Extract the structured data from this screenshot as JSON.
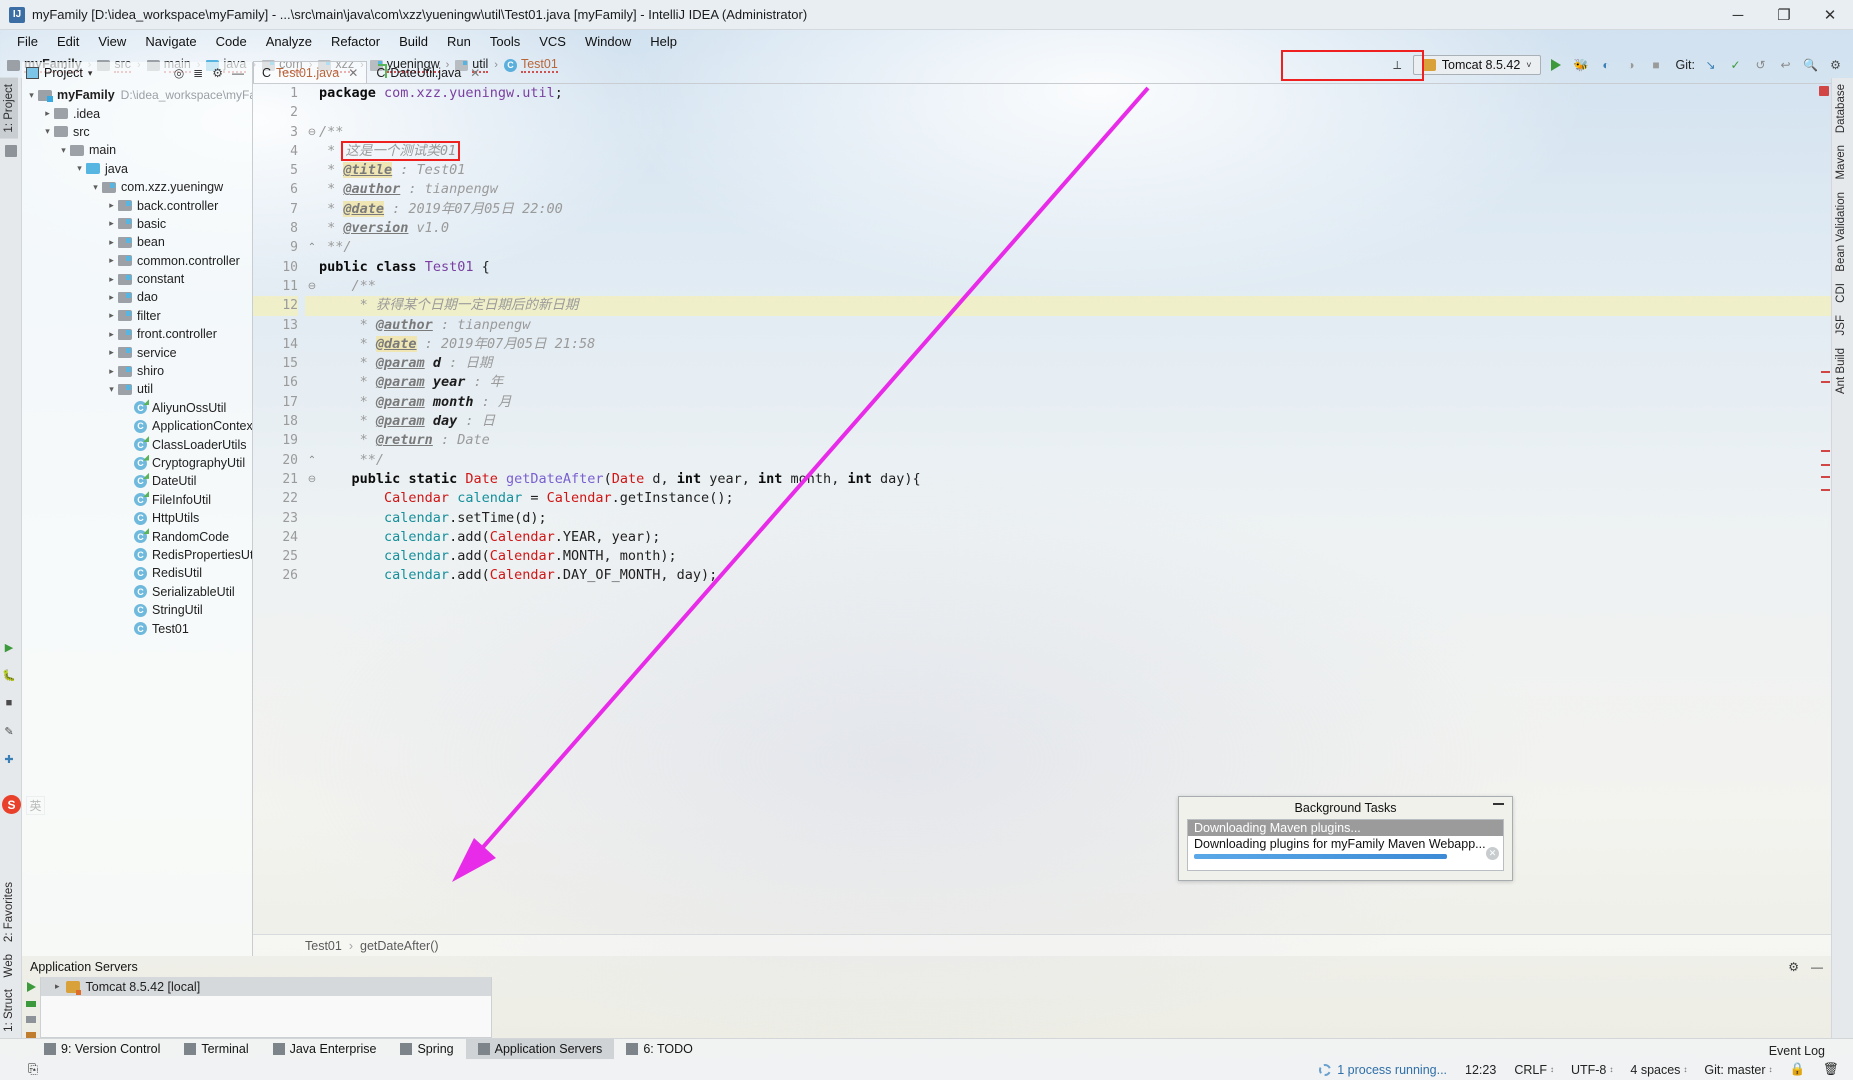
{
  "titlebar": {
    "app_icon": "intellij-logo-icon",
    "title": "myFamily [D:\\idea_workspace\\myFamily] - ...\\src\\main\\java\\com\\xzz\\yueningw\\util\\Test01.java [myFamily] - IntelliJ IDEA (Administrator)",
    "minimize": "─",
    "maximize": "❐",
    "close": "✕"
  },
  "menubar": {
    "items": [
      "File",
      "Edit",
      "View",
      "Navigate",
      "Code",
      "Analyze",
      "Refactor",
      "Build",
      "Run",
      "Tools",
      "VCS",
      "Window",
      "Help"
    ]
  },
  "breadcrumbs": [
    {
      "label": "myFamily",
      "icon": "project-folder-icon",
      "bold": true
    },
    {
      "label": "src",
      "icon": "folder-icon",
      "bold": false
    },
    {
      "label": "main",
      "icon": "folder-icon",
      "bold": false
    },
    {
      "label": "java",
      "icon": "source-folder-icon",
      "bold": false
    },
    {
      "label": "com",
      "icon": "package-icon",
      "bold": false
    },
    {
      "label": "xzz",
      "icon": "package-icon",
      "bold": false
    },
    {
      "label": "yueningw",
      "icon": "package-icon",
      "bold": false
    },
    {
      "label": "util",
      "icon": "package-icon",
      "bold": false
    },
    {
      "label": "Test01",
      "icon": "java-class-icon",
      "bold": false
    }
  ],
  "toolbar": {
    "run_config": "Tomcat 8.5.42",
    "run_config_icon": "tomcat-cat-icon",
    "dropdown_caret": "˅",
    "run_button": "run-icon",
    "debug_button": "debug-icon",
    "run_coverage_button": "run-with-coverage-icon",
    "profile_button": "profile-icon",
    "stop_button": "stop-icon",
    "git_label": "Git:",
    "git_update": "update-project-icon",
    "git_commit": "commit-icon",
    "git_history": "history-icon",
    "git_revert": "revert-icon",
    "search_everywhere": "magnifier-icon",
    "settings": "gear-icon",
    "highlight_box_color": "#ef2020"
  },
  "left_strip": {
    "top_tabs": [
      {
        "label": "1: Project",
        "active": true
      }
    ],
    "bottom_tabs": [
      {
        "label": "2: Favorites",
        "active": false
      },
      {
        "label": "Web",
        "active": false
      },
      {
        "label": "1: Struct",
        "active": false
      }
    ]
  },
  "right_strip": {
    "tabs": [
      "Database",
      "Maven",
      "Bean Validation",
      "CDI",
      "JSF",
      "Ant Build"
    ]
  },
  "project_panel": {
    "title": "Project",
    "caret": "▾",
    "icons": [
      "locate-icon",
      "collapse-all-icon",
      "gear-icon",
      "hide-icon"
    ],
    "tree": [
      {
        "depth": 0,
        "arrow": "open",
        "icon": "project-folder-icon",
        "label": "myFamily",
        "bold": true,
        "path": "D:\\idea_workspace\\myFamil"
      },
      {
        "depth": 1,
        "arrow": "closed",
        "icon": "folder-icon",
        "label": ".idea"
      },
      {
        "depth": 1,
        "arrow": "open",
        "icon": "folder-icon",
        "label": "src"
      },
      {
        "depth": 2,
        "arrow": "open",
        "icon": "folder-icon",
        "label": "main"
      },
      {
        "depth": 3,
        "arrow": "open",
        "icon": "source-folder-icon",
        "label": "java"
      },
      {
        "depth": 4,
        "arrow": "open",
        "icon": "package-icon",
        "label": "com.xzz.yueningw"
      },
      {
        "depth": 5,
        "arrow": "closed",
        "icon": "package-icon",
        "label": "back.controller"
      },
      {
        "depth": 5,
        "arrow": "closed",
        "icon": "package-icon",
        "label": "basic"
      },
      {
        "depth": 5,
        "arrow": "closed",
        "icon": "package-icon",
        "label": "bean"
      },
      {
        "depth": 5,
        "arrow": "closed",
        "icon": "package-icon",
        "label": "common.controller"
      },
      {
        "depth": 5,
        "arrow": "closed",
        "icon": "package-icon",
        "label": "constant"
      },
      {
        "depth": 5,
        "arrow": "closed",
        "icon": "package-icon",
        "label": "dao"
      },
      {
        "depth": 5,
        "arrow": "closed",
        "icon": "package-icon",
        "label": "filter"
      },
      {
        "depth": 5,
        "arrow": "closed",
        "icon": "package-icon",
        "label": "front.controller"
      },
      {
        "depth": 5,
        "arrow": "closed",
        "icon": "package-icon",
        "label": "service"
      },
      {
        "depth": 5,
        "arrow": "closed",
        "icon": "package-icon",
        "label": "shiro"
      },
      {
        "depth": 5,
        "arrow": "open",
        "icon": "package-icon",
        "label": "util"
      },
      {
        "depth": 6,
        "arrow": "none",
        "icon": "java-class-public-icon",
        "label": "AliyunOssUtil"
      },
      {
        "depth": 6,
        "arrow": "none",
        "icon": "java-class-icon",
        "label": "ApplicationContext"
      },
      {
        "depth": 6,
        "arrow": "none",
        "icon": "java-class-public-icon",
        "label": "ClassLoaderUtils"
      },
      {
        "depth": 6,
        "arrow": "none",
        "icon": "java-class-public-icon",
        "label": "CryptographyUtil"
      },
      {
        "depth": 6,
        "arrow": "none",
        "icon": "java-class-public-icon",
        "label": "DateUtil"
      },
      {
        "depth": 6,
        "arrow": "none",
        "icon": "java-class-public-icon",
        "label": "FileInfoUtil"
      },
      {
        "depth": 6,
        "arrow": "none",
        "icon": "java-class-icon",
        "label": "HttpUtils"
      },
      {
        "depth": 6,
        "arrow": "none",
        "icon": "java-class-public-icon",
        "label": "RandomCode"
      },
      {
        "depth": 6,
        "arrow": "none",
        "icon": "java-class-icon",
        "label": "RedisPropertiesUtil"
      },
      {
        "depth": 6,
        "arrow": "none",
        "icon": "java-class-icon",
        "label": "RedisUtil"
      },
      {
        "depth": 6,
        "arrow": "none",
        "icon": "java-class-icon",
        "label": "SerializableUtil"
      },
      {
        "depth": 6,
        "arrow": "none",
        "icon": "java-class-icon",
        "label": "StringUtil"
      },
      {
        "depth": 6,
        "arrow": "none",
        "icon": "java-class-icon",
        "label": "Test01"
      }
    ]
  },
  "editor": {
    "tabs": [
      {
        "label": "Test01.java",
        "icon": "java-class-icon",
        "active": true,
        "close": "✕"
      },
      {
        "label": "DateUtil.java",
        "icon": "java-class-public-icon",
        "active": false,
        "close": "✕"
      }
    ],
    "first_line": 1,
    "last_line": 26,
    "highlight_line": 12,
    "red_outline_line": 4,
    "breadcrumb": {
      "class": "Test01",
      "separator": "›",
      "method": "getDateAfter()"
    },
    "lines": [
      {
        "n": 1,
        "fold": "",
        "text": "package com.xzz.yueningw.util;"
      },
      {
        "n": 2,
        "fold": "",
        "text": ""
      },
      {
        "n": 3,
        "fold": "-",
        "text": "/**"
      },
      {
        "n": 4,
        "fold": "",
        "text": " * 这是一个测试类01"
      },
      {
        "n": 5,
        "fold": "",
        "text": " * @title : Test01"
      },
      {
        "n": 6,
        "fold": "",
        "text": " * @author : tianpengw"
      },
      {
        "n": 7,
        "fold": "",
        "text": " * @date : 2019年07月05日 22:00"
      },
      {
        "n": 8,
        "fold": "",
        "text": " * @version v1.0"
      },
      {
        "n": 9,
        "fold": "^",
        "text": " **/"
      },
      {
        "n": 10,
        "fold": "",
        "text": "public class Test01 {"
      },
      {
        "n": 11,
        "fold": "-",
        "text": "    /**"
      },
      {
        "n": 12,
        "fold": "",
        "text": "     * 获得某个日期一定日期后的新日期"
      },
      {
        "n": 13,
        "fold": "",
        "text": "     * @author : tianpengw"
      },
      {
        "n": 14,
        "fold": "",
        "text": "     * @date : 2019年07月05日 21:58"
      },
      {
        "n": 15,
        "fold": "",
        "text": "     * @param d : 日期"
      },
      {
        "n": 16,
        "fold": "",
        "text": "     * @param year : 年"
      },
      {
        "n": 17,
        "fold": "",
        "text": "     * @param month : 月"
      },
      {
        "n": 18,
        "fold": "",
        "text": "     * @param day : 日"
      },
      {
        "n": 19,
        "fold": "",
        "text": "     * @return : Date"
      },
      {
        "n": 20,
        "fold": "^",
        "text": "     **/"
      },
      {
        "n": 21,
        "fold": "-",
        "text": "    public static Date getDateAfter(Date d, int year, int month, int day){"
      },
      {
        "n": 22,
        "fold": "",
        "text": "        Calendar calendar = Calendar.getInstance();"
      },
      {
        "n": 23,
        "fold": "",
        "text": "        calendar.setTime(d);"
      },
      {
        "n": 24,
        "fold": "",
        "text": "        calendar.add(Calendar.YEAR, year);"
      },
      {
        "n": 25,
        "fold": "",
        "text": "        calendar.add(Calendar.MONTH, month);"
      },
      {
        "n": 26,
        "fold": "",
        "text": "        calendar.add(Calendar.DAY_OF_MONTH, day);"
      }
    ]
  },
  "bottom_window": {
    "title": "Application Servers",
    "gear": "gear-icon",
    "hide": "hide-icon",
    "server": {
      "label": "Tomcat 8.5.42 [local]",
      "icon": "tomcat-cat-icon",
      "arrow": "▸"
    },
    "side_buttons": [
      "rerun-icon",
      "stop-icon",
      "pin-icon",
      "edit-icon",
      "settings-icon"
    ]
  },
  "background_tasks": {
    "title": "Background Tasks",
    "minimize": "minimize-icon",
    "task_header": "Downloading Maven plugins...",
    "task_detail": "Downloading plugins for myFamily Maven Webapp...",
    "progress_percent": 92,
    "cancel": "✕",
    "progress_color": "#4a93de"
  },
  "bottom_tabs": [
    {
      "label": "9: Version Control",
      "icon": "branch-icon",
      "active": false
    },
    {
      "label": "Terminal",
      "icon": "terminal-icon",
      "active": false
    },
    {
      "label": "Java Enterprise",
      "icon": "java-enterprise-icon",
      "active": false
    },
    {
      "label": "Spring",
      "icon": "spring-leaf-icon",
      "active": false
    },
    {
      "label": "Application Servers",
      "icon": "app-server-icon",
      "active": true
    },
    {
      "label": "6: TODO",
      "icon": "todo-list-icon",
      "active": false
    }
  ],
  "statusbar": {
    "process": "1 process running...",
    "time": "12:23",
    "line_separator": "CRLF",
    "encoding": "UTF-8",
    "indent": "4 spaces",
    "git_branch": "Git: master",
    "event_log": "Event Log",
    "lock_icon": "lock-icon",
    "trash_icon": "trash-icon",
    "stepper": "↕"
  },
  "annotation": {
    "arrow_color": "#e82be8",
    "box_color": "#ef2020"
  }
}
